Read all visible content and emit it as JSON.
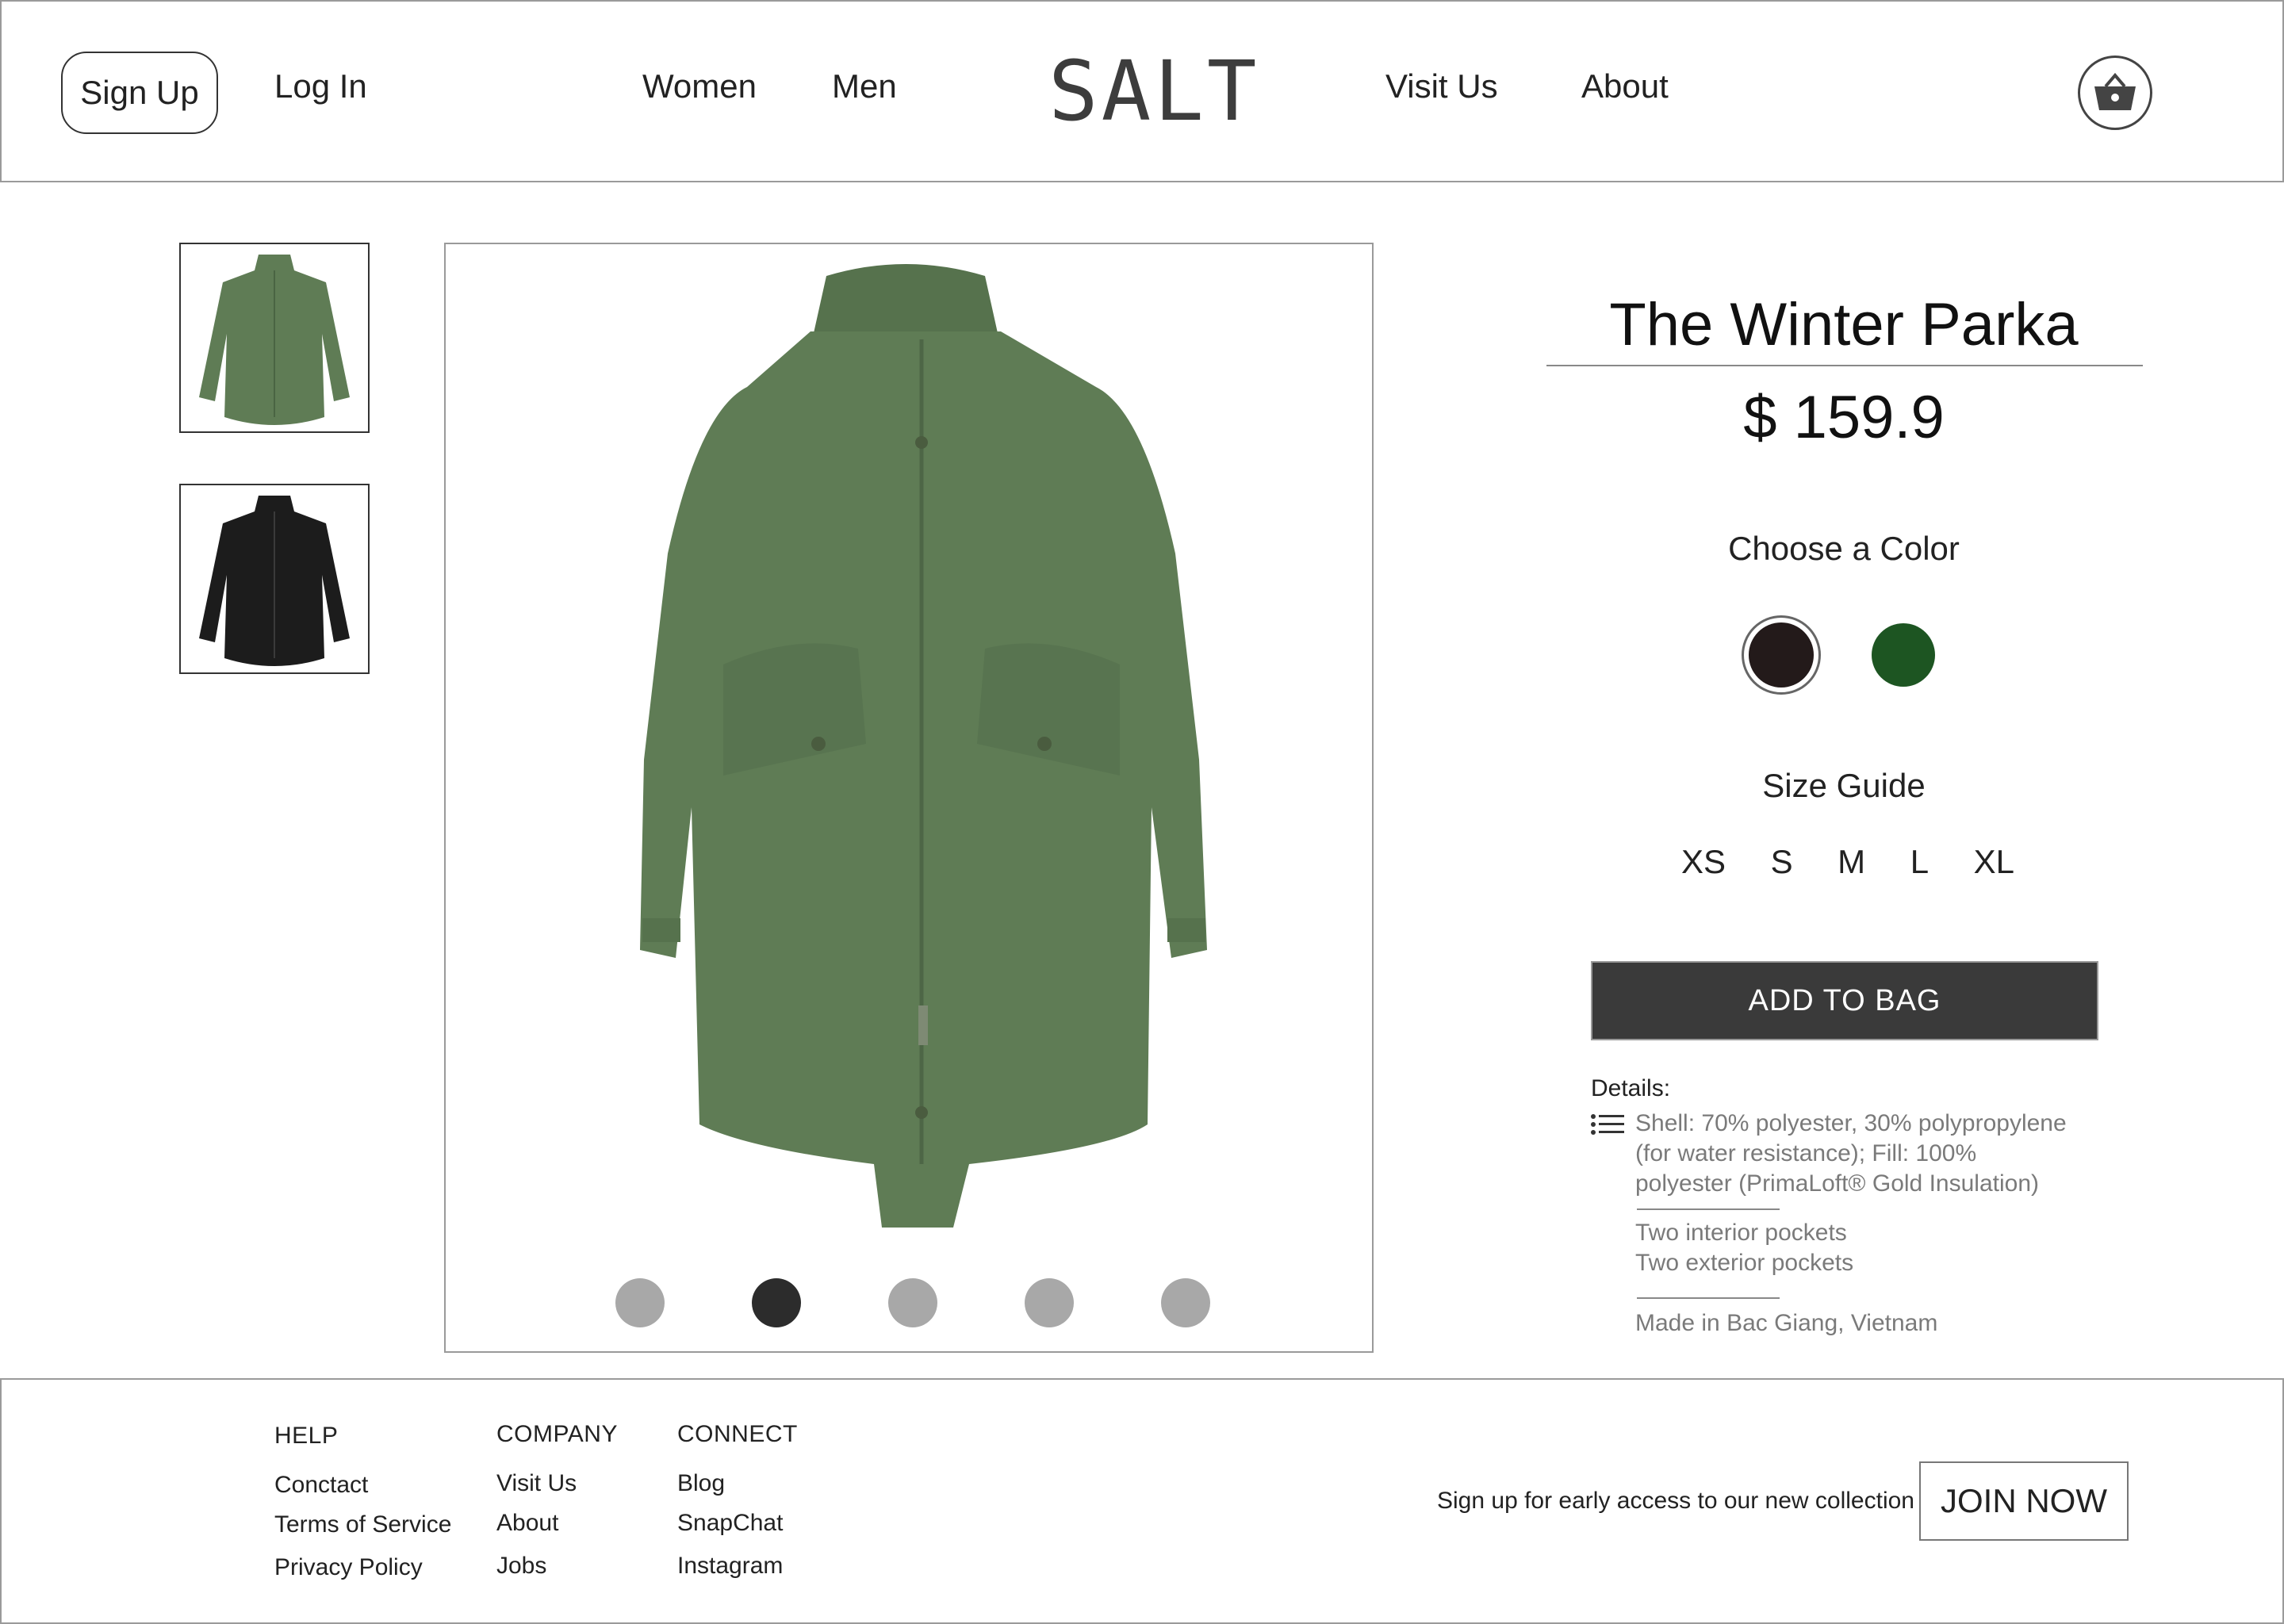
{
  "header": {
    "signup_label": "Sign Up",
    "login_label": "Log In",
    "nav": [
      "Women",
      "Men",
      "Visit Us",
      "About"
    ],
    "logo": "SALT",
    "cart_icon": "basket-icon"
  },
  "gallery": {
    "thumbnails": [
      {
        "alt": "green parka",
        "color": "#5f7c55"
      },
      {
        "alt": "black parka",
        "color": "#1c1c1c"
      }
    ],
    "main_image_color": "#5f7c55",
    "carousel_dots": 5,
    "active_dot": 1
  },
  "product": {
    "title": "The Winter Parka",
    "price": "$ 159.9",
    "color_label": "Choose a Color",
    "colors": [
      {
        "name": "black",
        "hex": "#231a1a",
        "selected": true
      },
      {
        "name": "green",
        "hex": "#1d5522",
        "selected": false
      }
    ],
    "size_label": "Size Guide",
    "sizes": [
      "XS",
      "S",
      "M",
      "L",
      "XL"
    ],
    "add_to_bag": "ADD TO BAG",
    "details_label": "Details:",
    "details": {
      "shell_line1": "Shell: 70% polyester, 30% polypropylene",
      "shell_line2": "(for water resistance); Fill: 100%",
      "shell_line3": "polyester (PrimaLoft® Gold Insulation)",
      "pockets1": "Two interior pockets",
      "pockets2": "Two exterior pockets",
      "origin": "Made in Bac Giang, Vietnam"
    }
  },
  "footer": {
    "help": {
      "heading": "HELP",
      "links": [
        "Conctact",
        "Terms of Service",
        "Privacy Policy"
      ]
    },
    "company": {
      "heading": "COMPANY",
      "links": [
        "Visit Us",
        "About",
        "Jobs"
      ]
    },
    "connect": {
      "heading": "CONNECT",
      "links": [
        "Blog",
        "SnapChat",
        "Instagram"
      ]
    },
    "signup_text": "Sign up for early access to our new collection",
    "join_label": "JOIN NOW"
  }
}
